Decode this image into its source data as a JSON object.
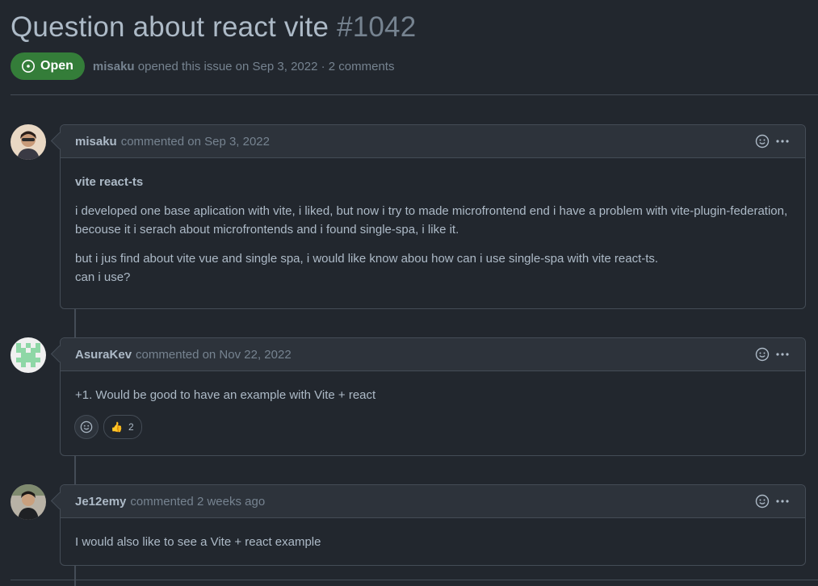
{
  "issue": {
    "title": "Question about react vite",
    "number": "#1042",
    "state_label": "Open",
    "opener": "misaku",
    "opened_text": "opened this issue on Sep 3, 2022 · 2 comments"
  },
  "comments": [
    {
      "author": "misaku",
      "timestamp": "commented on Sep 3, 2022",
      "paragraphs": [
        "vite react-ts",
        "i developed one base aplication with vite, i liked, but now i try to made microfrontend end i have a problem with vite-plugin-federation, becouse it i serach about microfrontends and i found single-spa, i like it.",
        "but i jus find about vite vue and single spa, i would like know abou how can i use single-spa with vite react-ts.",
        "can i use?"
      ]
    },
    {
      "author": "AsuraKev",
      "timestamp": "commented on Nov 22, 2022",
      "paragraphs": [
        "+1. Would be good to have an example with Vite + react"
      ],
      "reaction": {
        "emoji": "👍",
        "count": "2"
      }
    },
    {
      "author": "Je12emy",
      "timestamp": "commented 2 weeks ago",
      "paragraphs": [
        "I would also like to see a Vite + react example"
      ]
    }
  ],
  "colors": {
    "background": "#22272e",
    "header": "#2d333b",
    "border": "#444c56",
    "open_green": "#347d39",
    "muted": "#768390",
    "text": "#adbac7"
  }
}
